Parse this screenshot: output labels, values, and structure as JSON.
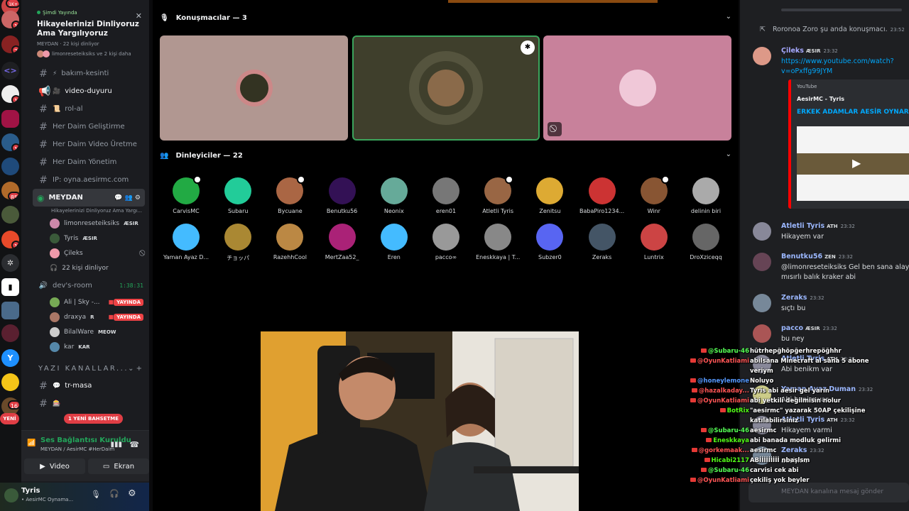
{
  "guilds": {
    "badges": [
      "1K+",
      "1",
      "2",
      "1",
      "1",
      "85",
      "1",
      "16"
    ],
    "new_label": "YENİ"
  },
  "event": {
    "live": "Şimdi Yayında",
    "title": "Hikayelerinizi Dinliyoruz Ama Yargılıyoruz",
    "meta": "MEYDAN · 22 kişi dinliyor",
    "speakers": "limonreseteiksiks ve 2 kişi daha"
  },
  "channels": [
    {
      "icon": "#",
      "emoji": "⚡",
      "name": "bakım-kesinti"
    },
    {
      "icon": "📢",
      "emoji": "🎥",
      "name": "video-duyuru",
      "unread": true
    },
    {
      "icon": "#",
      "emoji": "📜",
      "name": "rol-al"
    },
    {
      "icon": "#",
      "emoji": "",
      "name": "Her Daim Geliştirme"
    },
    {
      "icon": "#",
      "emoji": "",
      "name": "Her Daim Video Üretme"
    },
    {
      "icon": "#",
      "emoji": "",
      "name": "Her Daim Yönetim"
    },
    {
      "icon": "#",
      "emoji": "",
      "name": "IP: oyna.aesirmc.com"
    }
  ],
  "stage_channel": {
    "name": "MEYDAN",
    "desc": "Hikayelerinizi Dinliyoruz Ama Yargı...",
    "users": [
      {
        "name": "limonreseteiksiks",
        "tag": "ÆSIR"
      },
      {
        "name": "Tyris",
        "tag": "ÆSIR"
      },
      {
        "name": "Çileks",
        "tag": ""
      }
    ],
    "listeners": "22 kişi dinliyor"
  },
  "devroom": {
    "name": "dev's-room",
    "timer": "1:38:31",
    "users": [
      {
        "name": "Ali | Sky -...",
        "tag": "",
        "live": "YAYINDA"
      },
      {
        "name": "draxya",
        "tag": "R",
        "live": "YAYINDA"
      },
      {
        "name": "BilalWare",
        "tag": "MEOW",
        "live": ""
      },
      {
        "name": "kar",
        "tag": "KAR",
        "live": ""
      }
    ]
  },
  "text_category": "YAZI KANALLAR...",
  "text_channels": [
    {
      "emoji": "💬",
      "name": "tr-masa"
    },
    {
      "emoji": "🎰",
      "name": ""
    }
  ],
  "new_bet": "1 YENİ BAHSETME",
  "voice_status": {
    "title": "Ses Bağlantısı Kuruldu",
    "sub": "MEYDAN / AesirMC #HerDaim",
    "video": "Video",
    "screen": "Ekran"
  },
  "user": {
    "name": "Tyris",
    "status": "• AesirMC Oynama..."
  },
  "stage": {
    "speakers_header": "Konuşmacılar — 3",
    "listeners_header": "Dinleyiciler — 22",
    "tile_colors": [
      "#b19791",
      "#3f3f2c",
      "#c8819b"
    ],
    "listeners": [
      "CarvisMC",
      "Subaru",
      "Bycuane",
      "Benutku56",
      "Neonix",
      "eren01",
      "Atletli Tyris",
      "Zenitsu",
      "BabaPiro1234...",
      "Winr",
      "delinin biri",
      "Yaman Ayaz D...",
      "チョッパ",
      "RazehhCool",
      "MertZaa52_",
      "Eren",
      "pacco∞",
      "Eneskkaya | T...",
      "Subzer0",
      "Zeraks",
      "Luntrix",
      "DroXziceqq"
    ]
  },
  "chat": {
    "system": "Roronoa Zoro şu anda konuşmacı.",
    "system_time": "23:52",
    "embed": {
      "site": "YouTube",
      "author": "AesirMC - Tyris",
      "title": "ERKEK ADAMLAR AESİR OYNAR !kick"
    },
    "messages": [
      {
        "user": "Çileks",
        "color": "#a6a8ff",
        "tag": "ÆSIR",
        "time": "23:32",
        "text": "https://www.youtube.com/watch?",
        "text2": "v=oPxffg99JYM"
      },
      {
        "user": "Atletli Tyris",
        "color": "#9bb7ff",
        "tag": "ATH",
        "time": "23:32",
        "text": "Hikayem var"
      },
      {
        "user": "Benutku56",
        "color": "#9bb7ff",
        "tag": "ZEN",
        "time": "23:32",
        "text": "@limonreseteiksiks Gel ben sana alayım",
        "text2": "mısırlı balık kraker abi"
      },
      {
        "user": "Zeraks",
        "color": "#9bb7ff",
        "tag": "",
        "time": "23:32",
        "text": "sıçtı bu"
      },
      {
        "user": "pacco",
        "color": "#9bb7ff",
        "tag": "ÆSIR",
        "time": "23:32",
        "text": "bu ney"
      },
      {
        "user": "Atletli Tyris",
        "color": "#9bb7ff",
        "tag": "ATH",
        "time": "23:32",
        "text": "Abi benikm var"
      },
      {
        "user": "Yaman Ayaz Duman",
        "color": "#9bb7ff",
        "tag": "",
        "time": "23:32",
        "text": "Abi benim var"
      },
      {
        "user": "Atletli Tyris",
        "color": "#9bb7ff",
        "tag": "ATH",
        "time": "23:32",
        "text": "Hikayem varmi"
      },
      {
        "user": "Zeraks",
        "color": "#9bb7ff",
        "tag": "",
        "time": "23:32",
        "text": "aesirmc"
      }
    ],
    "composer": "MEYDAN kanalına mesaj gönder"
  },
  "overlay": [
    {
      "user": "@Subaru-46",
      "color": "#55ff55",
      "msg": "hütrhepğhöpğerhrepöğhhr"
    },
    {
      "user": "@OyunKatliami",
      "color": "#ff5555",
      "msg": "abilsana Minecraft al sana 5 abone"
    },
    {
      "user": "",
      "color": "#ff5555",
      "msg": "veriym"
    },
    {
      "user": "@honeylemone",
      "color": "#5599ff",
      "msg": "Noluyo"
    },
    {
      "user": "@hazalkaday...",
      "color": "#ff5555",
      "msg": "Tyris abi aesir gel yarın"
    },
    {
      "user": "@OyunKatliami",
      "color": "#ff5555",
      "msg": "abi yetkili değilmisin nolur"
    },
    {
      "user": "BotRix",
      "color": "#53fc18",
      "msg": "\"aesirmc\" yazarak 50AP çekilişine"
    },
    {
      "user": "",
      "color": "#fff",
      "msg": "katılabilirsiniz"
    },
    {
      "user": "@Subaru-46",
      "color": "#55ff55",
      "msg": "aesirmc"
    },
    {
      "user": "Eneskkaya",
      "color": "#53fc18",
      "msg": "abi banada modluk gelirmi"
    },
    {
      "user": "@gorkemaak...",
      "color": "#ff5555",
      "msg": "aesirmc"
    },
    {
      "user": "Hicabi2117",
      "color": "#53fc18",
      "msg": "ABİİİİİİİİİ nbaşlsm"
    },
    {
      "user": "@Subaru-46",
      "color": "#55ff55",
      "msg": "carvisi cek abi"
    },
    {
      "user": "@OyunKatliami",
      "color": "#ff5555",
      "msg": "çekiliş yok beyler"
    }
  ]
}
